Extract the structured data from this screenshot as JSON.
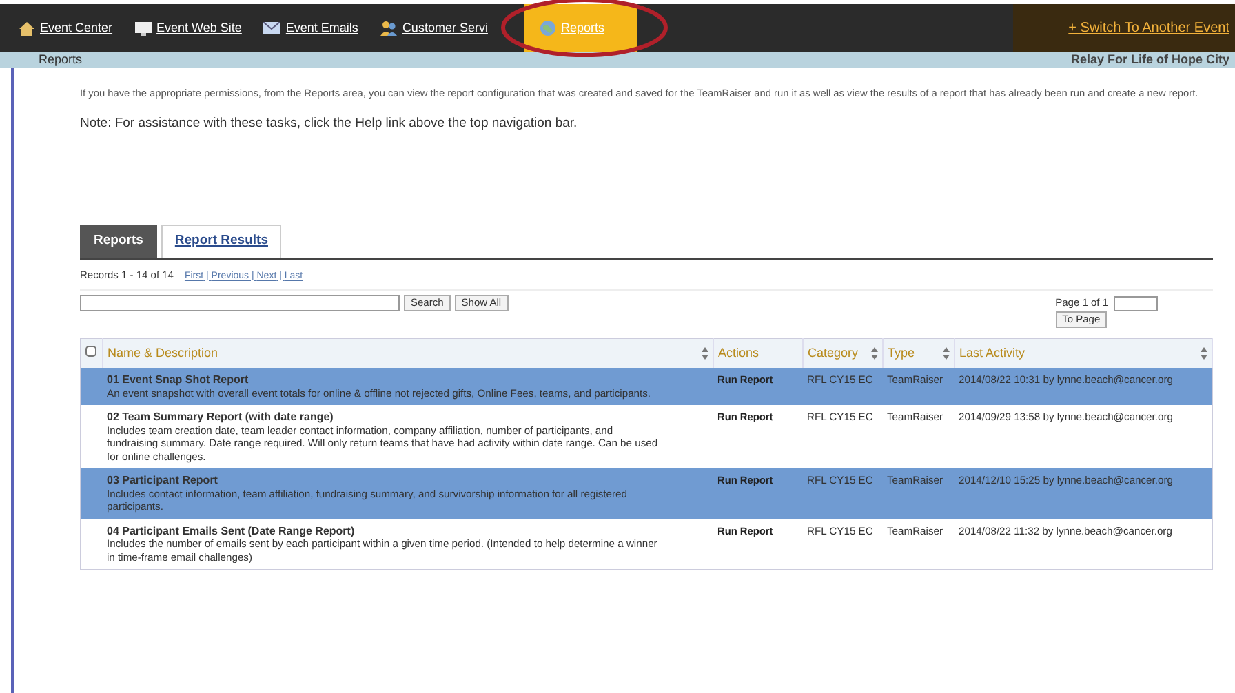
{
  "nav": {
    "items": [
      {
        "label": "Event Center",
        "selected": false
      },
      {
        "label": "Event Web Site",
        "selected": false
      },
      {
        "label": "Event Emails",
        "selected": false
      },
      {
        "label": "Customer Servi",
        "selected": false
      },
      {
        "label": "Reports",
        "selected": true
      }
    ],
    "switch_link": "+ Switch To Another Event"
  },
  "subheader": {
    "title": "Reports",
    "event": "Relay For Life of Hope City"
  },
  "intro": "If you have the appropriate permissions, from the Reports area, you can view the report configuration that was created and saved for the TeamRaiser and run it as well as view the results of a report that has already been run and create a new report.",
  "note": "Note: For assistance with these tasks, click the Help link above the top navigation bar.",
  "tabs": [
    {
      "label": "Reports",
      "selected": true
    },
    {
      "label": "Report Results",
      "selected": false
    }
  ],
  "records": "Records 1 - 14 of 14",
  "pager_links": [
    "First",
    "Previous",
    "Next",
    "Last"
  ],
  "pager_separator": "|",
  "select_all": {
    "checked": false
  },
  "search": {
    "search_button": "Search",
    "show_all_button": "Show All"
  },
  "page": {
    "label": "Page 1 of 1",
    "button": "To Page"
  },
  "table": {
    "columns": [
      {
        "label": "Name & Description",
        "sortable": true
      },
      {
        "label": "Actions",
        "sortable": false
      },
      {
        "label": "Category",
        "sortable": true
      },
      {
        "label": "Type",
        "sortable": true
      },
      {
        "label": "Last Activity",
        "sortable": true
      }
    ],
    "rows": [
      {
        "name": "01 Event Snap Shot Report",
        "description": "An event snapshot with overall event totals for online & offline not rejected gifts, Online Fees, teams, and participants.",
        "action": "Run Report",
        "category": "RFL CY15 EC",
        "type": "TeamRaiser",
        "last_activity": "2014/08/22 10:31 by lynne.beach@cancer.org",
        "selected": true
      },
      {
        "name": "02 Team Summary Report (with date range)",
        "description": "Includes team creation date, team leader contact information, company affiliation, number of participants, and fundraising summary. Date range required. Will only return teams that have had activity within date range. Can be used for online challenges.",
        "action": "Run Report",
        "category": "RFL CY15 EC",
        "type": "TeamRaiser",
        "last_activity": "2014/09/29 13:58 by lynne.beach@cancer.org",
        "selected": false
      },
      {
        "name": "03 Participant Report",
        "description": "Includes contact information, team affiliation, fundraising summary, and survivorship information for all registered participants.",
        "action": "Run Report",
        "category": "RFL CY15 EC",
        "type": "TeamRaiser",
        "last_activity": "2014/12/10 15:25 by lynne.beach@cancer.org",
        "selected": true
      },
      {
        "name": "04 Participant Emails Sent (Date Range Report)",
        "description": "Includes the number of emails sent by each participant within a given time period. (Intended to help determine a winner in time-frame email challenges)",
        "action": "Run Report",
        "category": "RFL CY15 EC",
        "type": "TeamRaiser",
        "last_activity": "2014/08/22 11:32 by lynne.beach@cancer.org",
        "selected": false
      }
    ]
  }
}
